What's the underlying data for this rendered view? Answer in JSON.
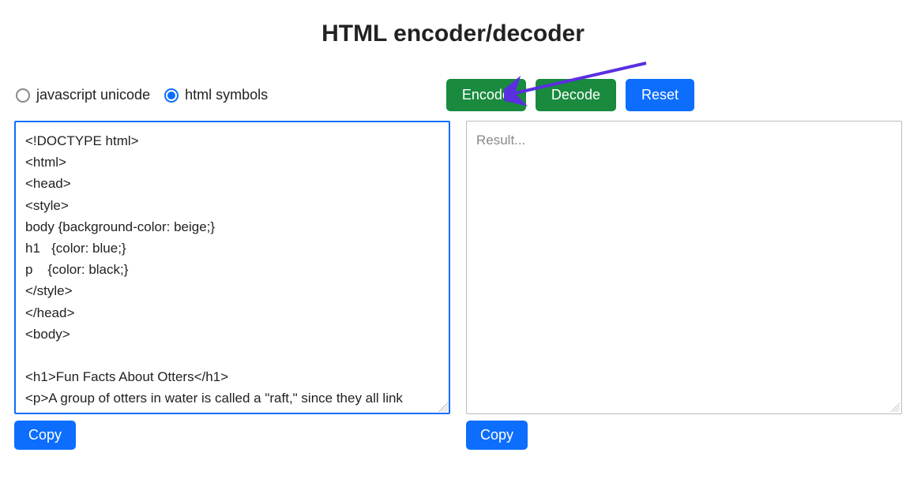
{
  "title": "HTML encoder/decoder",
  "radios": {
    "js_unicode": {
      "label": "javascript unicode",
      "checked": false
    },
    "html_symbols": {
      "label": "html symbols",
      "checked": true
    }
  },
  "buttons": {
    "encode": "Encode",
    "decode": "Decode",
    "reset": "Reset",
    "copy_left": "Copy",
    "copy_right": "Copy"
  },
  "input_textarea": {
    "value": "<!DOCTYPE html>\n<html>\n<head>\n<style>\nbody {background-color: beige;}\nh1   {color: blue;}\np    {color: black;}\n</style>\n</head>\n<body>\n\n<h1>Fun Facts About Otters</h1>\n<p>A group of otters in water is called a \"raft,\" since they all link arms to prevent from floating away.</p>\n\n</body>"
  },
  "result_textarea": {
    "value": "",
    "placeholder": "Result..."
  },
  "annotation": {
    "arrow_target": "encode-button",
    "arrow_color": "#5a2fe0"
  }
}
